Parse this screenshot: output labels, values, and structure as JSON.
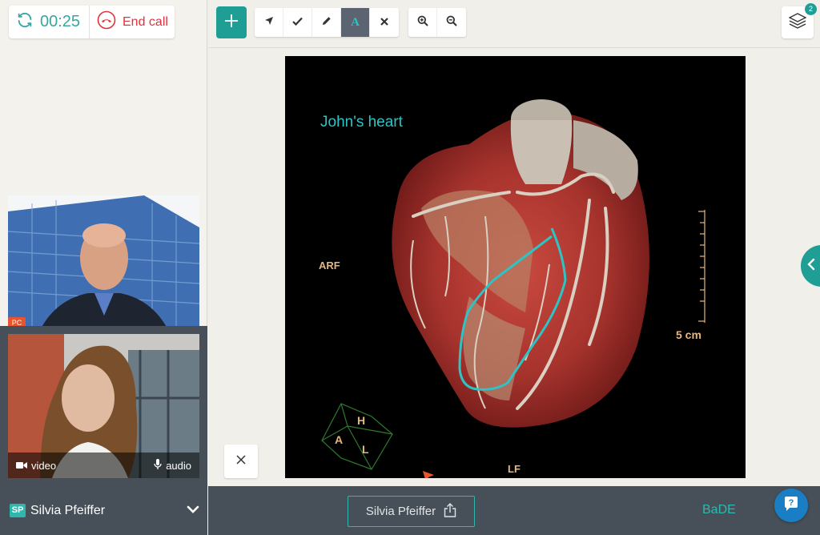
{
  "call": {
    "timer": "00:25",
    "end_label": "End call"
  },
  "video": {
    "remote_badge": "PC",
    "video_label": "video",
    "audio_label": "audio"
  },
  "user": {
    "initials": "SP",
    "name": "Silvia Pfeiffer"
  },
  "toolbar": {
    "tools": [
      "pointer-icon",
      "check-icon",
      "pencil-icon",
      "text-icon",
      "close-icon",
      "zoom-in-icon",
      "zoom-out-icon"
    ],
    "active_tool": "text-icon",
    "text_tool_letter": "A",
    "layers_count": "2"
  },
  "annotations": {
    "title": "John's heart",
    "arf": "ARF",
    "lf": "LF",
    "scale": "5 cm",
    "cube_h": "H",
    "cube_a": "A",
    "cube_l": "L"
  },
  "bottom": {
    "share_name": "Silvia Pfeiffer",
    "room": "BaDE"
  },
  "colors": {
    "accent": "#1e9e94",
    "end_call": "#e0323c",
    "panel_dark": "#475058",
    "annotation": "#2ec3c5"
  }
}
